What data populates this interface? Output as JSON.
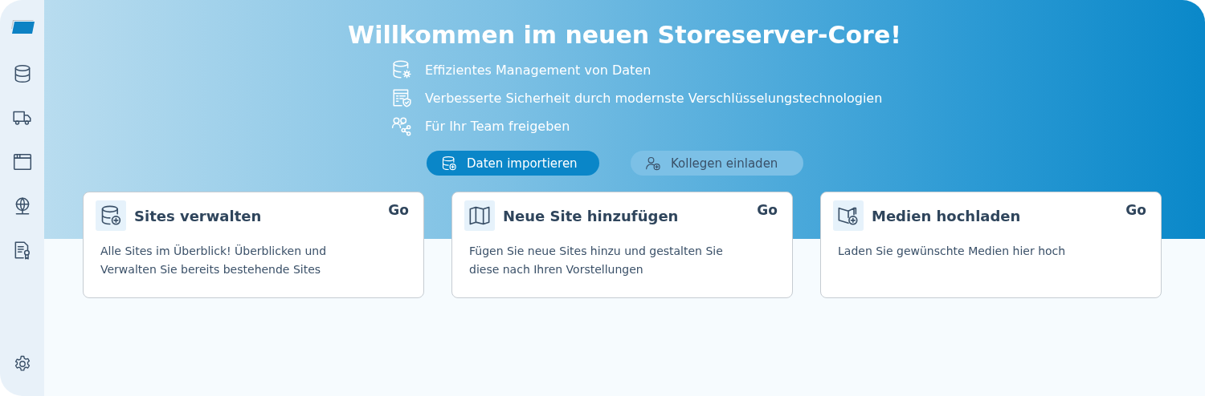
{
  "sidebar": {
    "items": [
      {
        "kind": "database"
      },
      {
        "kind": "truck"
      },
      {
        "kind": "browser"
      },
      {
        "kind": "globe"
      },
      {
        "kind": "certificate"
      }
    ],
    "footer": {
      "kind": "settings"
    }
  },
  "hero": {
    "title": "Willkommen im neuen Storeserver-Core!",
    "features": [
      {
        "kind": "database-gear",
        "text": "Effizientes Management von Daten"
      },
      {
        "kind": "document-shield",
        "text": "Verbesserte Sicherheit durch modernste Verschlüsselungstechnologien"
      },
      {
        "kind": "people-share",
        "text": "Für Ihr Team freigeben"
      }
    ],
    "buttons": [
      {
        "kind": "primary",
        "label": "Daten importieren"
      },
      {
        "kind": "secondary",
        "label": "Kollegen einladen"
      }
    ]
  },
  "cards": [
    {
      "kind": "database-add",
      "title": "Sites verwalten",
      "action": "Go",
      "description": "Alle Sites im Überblick! Überblicken und Verwalten Sie bereits bestehende Sites"
    },
    {
      "kind": "map",
      "title": "Neue Site hinzufügen",
      "action": "Go",
      "description": "Fügen Sie neue Sites hinzu und gestalten Sie diese nach Ihren Vorstellungen"
    },
    {
      "kind": "book-add",
      "title": "Medien hochladen",
      "action": "Go",
      "description": "Laden Sie gewünschte Medien hier hoch"
    }
  ]
}
